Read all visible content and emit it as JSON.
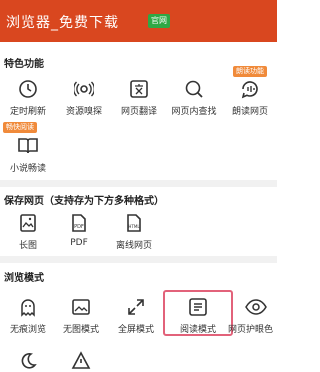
{
  "header": {
    "title": "浏览器_免费下载",
    "badge": "官网"
  },
  "sections": {
    "features": {
      "title": "特色功能",
      "items": [
        {
          "label": "定时刷新",
          "icon": "timer-refresh-icon"
        },
        {
          "label": "资源嗅探",
          "icon": "resource-sniff-icon"
        },
        {
          "label": "网页翻译",
          "icon": "translate-icon"
        },
        {
          "label": "网页内查找",
          "icon": "find-in-page-icon"
        },
        {
          "label": "朗读网页",
          "icon": "read-aloud-icon",
          "tag": "朗读功能"
        },
        {
          "label": "小说畅读",
          "icon": "book-icon",
          "tag": "畅快阅读"
        }
      ]
    },
    "save": {
      "title": "保存网页（支持存为下方多种格式）",
      "items": [
        {
          "label": "长图",
          "icon": "long-image-icon"
        },
        {
          "label": "PDF",
          "icon": "pdf-file-icon"
        },
        {
          "label": "离线网页",
          "icon": "html-file-icon"
        }
      ]
    },
    "browse": {
      "title": "浏览模式",
      "items": [
        {
          "label": "无痕浏览",
          "icon": "ghost-icon"
        },
        {
          "label": "无图模式",
          "icon": "no-image-icon"
        },
        {
          "label": "全屏模式",
          "icon": "fullscreen-icon"
        },
        {
          "label": "阅读模式",
          "icon": "reading-mode-icon"
        },
        {
          "label": "网页护眼色",
          "icon": "eye-icon"
        }
      ]
    }
  }
}
